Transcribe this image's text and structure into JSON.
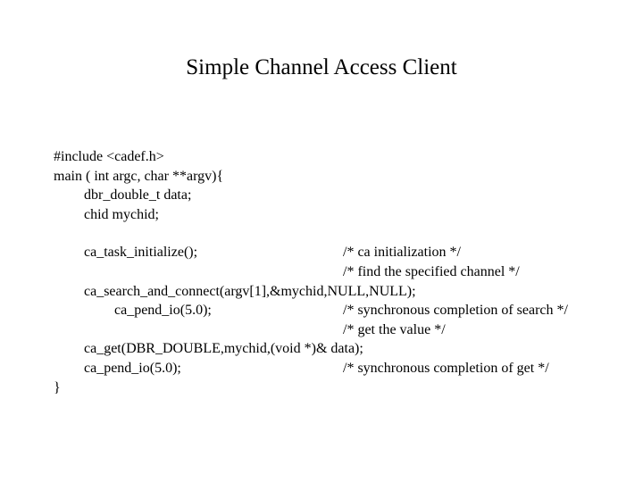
{
  "title": "Simple Channel Access Client",
  "code": {
    "l1": "#include <cadef.h>",
    "l2": "main ( int argc, char **argv){",
    "l3": "dbr_double_t data;",
    "l4": "chid mychid;",
    "l5_left": "ca_task_initialize();",
    "l5_right": "/* ca initialization */",
    "l6_right": "/* find the specified channel */",
    "l7": "ca_search_and_connect(argv[1],&mychid,NULL,NULL);",
    "l8_left": "ca_pend_io(5.0);",
    "l8_right": "/* synchronous completion of search */",
    "l9_right": "/* get the value */",
    "l10": "ca_get(DBR_DOUBLE,mychid,(void *)& data);",
    "l11_left": "ca_pend_io(5.0);",
    "l11_right": "/* synchronous completion of get */",
    "l12": "}"
  }
}
